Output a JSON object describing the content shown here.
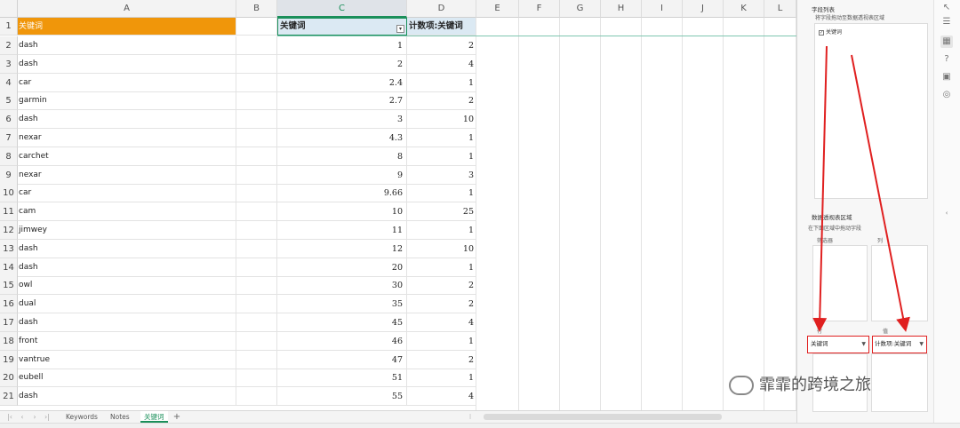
{
  "columns": [
    "A",
    "B",
    "C",
    "D",
    "E",
    "F",
    "G",
    "H",
    "I",
    "J",
    "K",
    "L"
  ],
  "header_row": {
    "num": "1",
    "a": "关键词",
    "c": "关键词",
    "d": "计数项:关键词"
  },
  "rows": [
    {
      "num": "2",
      "a": "dash",
      "c": "1",
      "d": "2"
    },
    {
      "num": "3",
      "a": "dash",
      "c": "2",
      "d": "4"
    },
    {
      "num": "4",
      "a": "car",
      "c": "2.4",
      "d": "1"
    },
    {
      "num": "5",
      "a": "garmin",
      "c": "2.7",
      "d": "2"
    },
    {
      "num": "6",
      "a": "dash",
      "c": "3",
      "d": "10"
    },
    {
      "num": "7",
      "a": "nexar",
      "c": "4.3",
      "d": "1"
    },
    {
      "num": "8",
      "a": "carchet",
      "c": "8",
      "d": "1"
    },
    {
      "num": "9",
      "a": "nexar",
      "c": "9",
      "d": "3"
    },
    {
      "num": "10",
      "a": "car",
      "c": "9.66",
      "d": "1"
    },
    {
      "num": "11",
      "a": "cam",
      "c": "10",
      "d": "25"
    },
    {
      "num": "12",
      "a": "jimwey",
      "c": "11",
      "d": "1"
    },
    {
      "num": "13",
      "a": "dash",
      "c": "12",
      "d": "10"
    },
    {
      "num": "14",
      "a": "dash",
      "c": "20",
      "d": "1"
    },
    {
      "num": "15",
      "a": "owl",
      "c": "30",
      "d": "2"
    },
    {
      "num": "16",
      "a": "dual",
      "c": "35",
      "d": "2"
    },
    {
      "num": "17",
      "a": "dash",
      "c": "45",
      "d": "4"
    },
    {
      "num": "18",
      "a": "front",
      "c": "46",
      "d": "1"
    },
    {
      "num": "19",
      "a": "vantrue",
      "c": "47",
      "d": "2"
    },
    {
      "num": "20",
      "a": "eubell",
      "c": "51",
      "d": "1"
    },
    {
      "num": "21",
      "a": "dash",
      "c": "55",
      "d": "4"
    }
  ],
  "sheet_tabs": [
    "Keywords",
    "Notes",
    "关键词"
  ],
  "active_tab": "关键词",
  "add_tab_symbol": "+",
  "pane": {
    "field_list_title": "字段列表",
    "field_list_hint": "将字段拖动至数据透视表区域",
    "field_item": "关键词",
    "areas_title": "数据透视表区域",
    "areas_hint": "在下面区域中拖动字段",
    "filter_label": "筛选器",
    "column_label": "列",
    "row_label": "行",
    "value_label": "值",
    "row_dropdown": "关键词",
    "value_dropdown": "计数项:关键词"
  },
  "watermark": "霏霏的跨境之旅",
  "colors": {
    "header_orange": "#f0960a",
    "pivot_header": "#dbe9f3",
    "accent_green": "#1a8f5a",
    "arrow_red": "#e02020"
  }
}
